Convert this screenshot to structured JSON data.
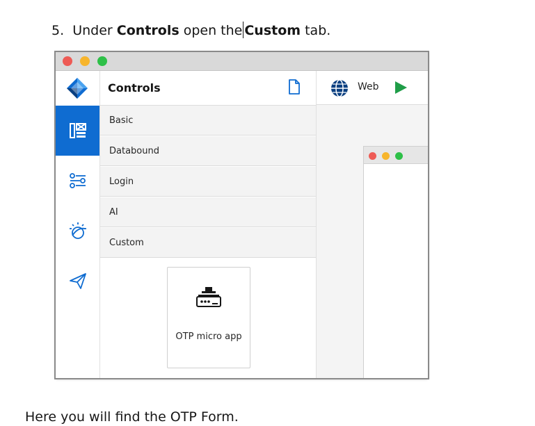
{
  "instruction": {
    "number": "5.",
    "text_1": "Under",
    "bold_1": "Controls",
    "text_2": "open the",
    "bold_2": "Custom",
    "text_3": "tab."
  },
  "footer_text": "Here you will find the OTP Form.",
  "window": {
    "controls_panel": {
      "title": "Controls",
      "categories": [
        "Basic",
        "Databound",
        "Login",
        "AI",
        "Custom"
      ],
      "card_label": "OTP micro app"
    },
    "preview": {
      "target_label": "Web"
    },
    "rail_icons": [
      "app-logo-icon",
      "components-icon",
      "settings-sliders-icon",
      "ai-watson-icon",
      "send-icon"
    ]
  },
  "colors": {
    "accent": "#0f6cd1",
    "play": "#1f9d48",
    "category_bg": "#f3f3f3"
  }
}
